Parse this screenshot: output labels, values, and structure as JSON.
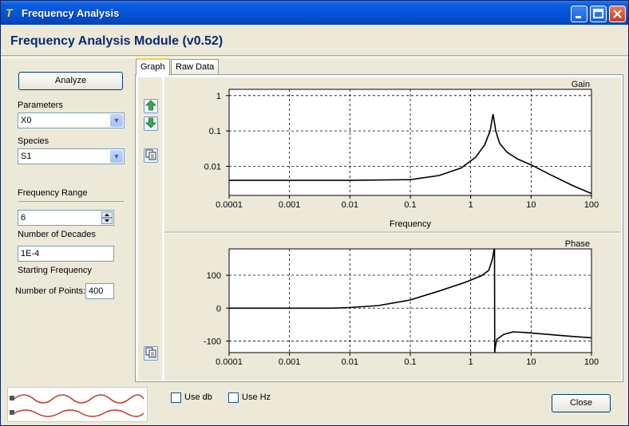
{
  "window": {
    "title": "Frequency Analysis",
    "icon_text": "T"
  },
  "header": {
    "module_title": "Frequency Analysis Module (v0.52)"
  },
  "left": {
    "analyze_label": "Analyze",
    "parameters_label": "Parameters",
    "parameters_value": "X0",
    "species_label": "Species",
    "species_value": "S1",
    "frequency_range_label": "Frequency Range",
    "decades_value": "6",
    "decades_label": "Number of Decades",
    "start_value": "1E-4",
    "start_label": "Starting Frequency",
    "points_label": "Number of Points:",
    "points_value": "400"
  },
  "tabs": [
    {
      "label": "Graph"
    },
    {
      "label": "Raw Data"
    }
  ],
  "toolbar": {
    "up_icon": "arrow-up-icon",
    "down_icon": "arrow-down-icon",
    "copy_icon": "copy-icon"
  },
  "bottom": {
    "use_db_label": "Use db",
    "use_hz_label": "Use Hz",
    "close_label": "Close"
  },
  "chart_data": [
    {
      "type": "line",
      "title": "Gain",
      "xlabel": "Frequency",
      "ylabel": "",
      "x_scale": "log",
      "y_scale": "log",
      "xlim": [
        0.0001,
        100
      ],
      "ylim": [
        0.0015,
        1.5
      ],
      "x_ticks": [
        "0.0001",
        "0.001",
        "0.01",
        "0.1",
        "1",
        "10",
        "100"
      ],
      "y_ticks": [
        "1",
        "0.1",
        "0.01"
      ],
      "grid": true,
      "series": [
        {
          "x": [
            0.0001,
            0.001,
            0.01,
            0.1,
            0.3,
            0.7,
            1.2,
            1.7,
            2.1,
            2.35,
            2.6,
            3.0,
            4.0,
            6.0,
            10,
            20,
            50,
            100
          ],
          "y": [
            0.004,
            0.004,
            0.004,
            0.0042,
            0.0055,
            0.009,
            0.018,
            0.04,
            0.1,
            0.3,
            0.1,
            0.045,
            0.025,
            0.016,
            0.011,
            0.006,
            0.0028,
            0.0017
          ]
        }
      ]
    },
    {
      "type": "line",
      "title": "Phase",
      "xlabel": "",
      "ylabel": "",
      "x_scale": "log",
      "xlim": [
        0.0001,
        100
      ],
      "ylim": [
        -135,
        180
      ],
      "x_ticks": [
        "0.0001",
        "0.001",
        "0.01",
        "0.1",
        "1",
        "10",
        "100"
      ],
      "y_ticks": [
        "100",
        "0",
        "-100"
      ],
      "grid": true,
      "series": [
        {
          "x": [
            0.0001,
            0.001,
            0.005,
            0.01,
            0.03,
            0.1,
            0.3,
            0.8,
            1.5,
            2.0,
            2.3,
            2.45,
            2.48,
            2.5,
            2.55,
            2.7,
            3.5,
            5.0,
            8.0,
            20,
            50,
            100
          ],
          "y": [
            0,
            0,
            0,
            2,
            8,
            25,
            52,
            78,
            98,
            115,
            150,
            180,
            180,
            -135,
            -120,
            -95,
            -80,
            -72,
            -74,
            -80,
            -86,
            -90
          ]
        }
      ]
    }
  ]
}
